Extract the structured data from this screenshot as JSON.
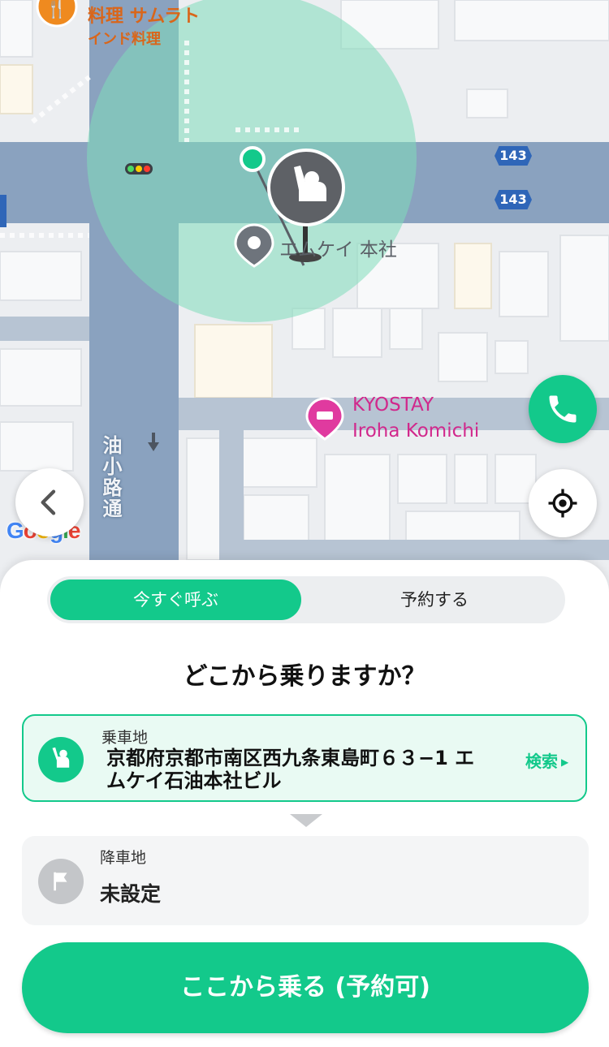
{
  "map": {
    "restaurant": {
      "name": "料理 サムラト",
      "type": "インド料理"
    },
    "landmark_label": "エムケイ 本社",
    "hotel": {
      "line1": "KYOSTAY",
      "line2": "Iroha Komichi"
    },
    "street_label": "油小路通",
    "route_numbers": [
      "143",
      "143"
    ],
    "attribution": "Google",
    "pickup_radius_color": "#7fdcb9",
    "road_color": "#8aa2bf"
  },
  "buttons": {
    "back_icon": "chevron-left-icon",
    "locate_icon": "crosshair-icon",
    "call_icon": "phone-icon"
  },
  "sheet": {
    "tabs": [
      {
        "label": "今すぐ呼ぶ",
        "active": true
      },
      {
        "label": "予約する",
        "active": false
      }
    ],
    "question": "どこから乗りますか？",
    "pickup": {
      "label": "乗車地",
      "address": "京都府京都市南区西九条東島町６３−1 エムケイ石油本社ビル",
      "search_label": "検索"
    },
    "dropoff": {
      "label": "降車地",
      "value": "未設定"
    },
    "confirm_label": "ここから乗る (予約可)"
  },
  "colors": {
    "accent": "#13c98b",
    "pickup_card_bg": "#e9faf3",
    "dropoff_icon_bg": "#c4c6c9"
  }
}
